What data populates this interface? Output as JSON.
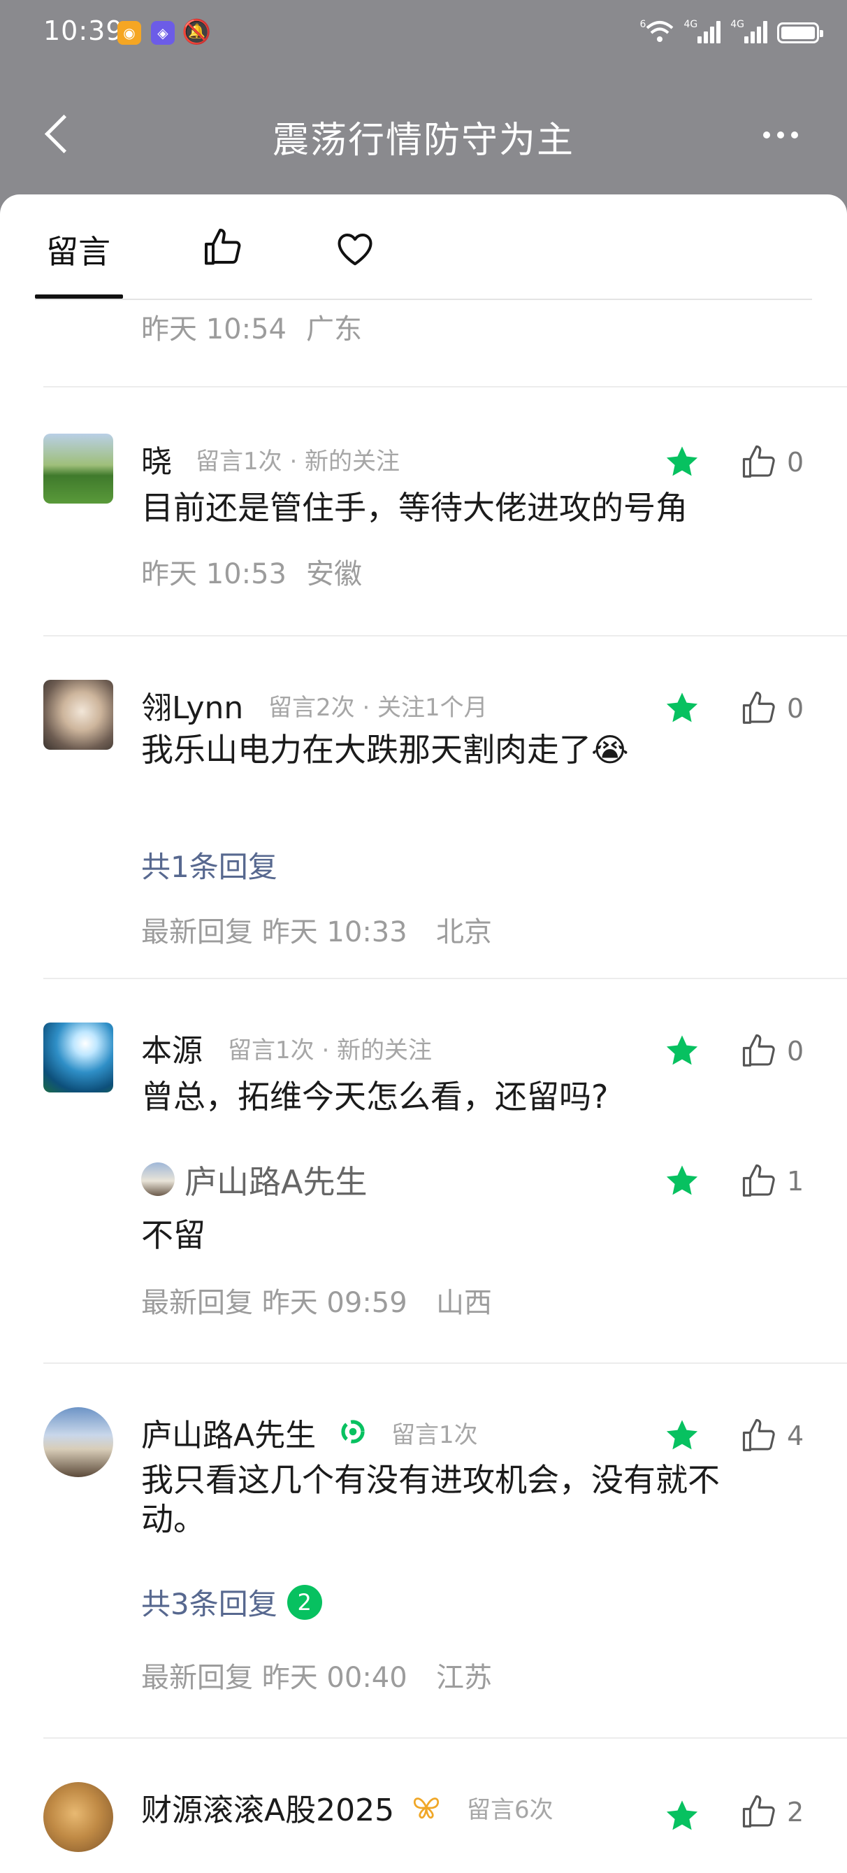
{
  "status": {
    "time": "10:39",
    "net1": "4G",
    "net2": "4G",
    "wifi_label": "6"
  },
  "nav": {
    "title": "震荡行情防守为主"
  },
  "tabs": {
    "messages": "留言"
  },
  "top_meta": {
    "time": "昨天 10:54",
    "location": "广东"
  },
  "comments": [
    {
      "name": "晓",
      "info": "留言1次 · 新的关注",
      "text": "目前还是管住手，等待大佬进攻的号角",
      "time": "昨天 10:53",
      "location": "安徽",
      "likes": "0"
    },
    {
      "name": "翎Lynn",
      "info": "留言2次 · 关注1个月",
      "text": "我乐山电力在大跌那天割肉走了😭",
      "replies": "共1条回复",
      "latest": "最新回复 昨天 10:33",
      "location": "北京",
      "likes": "0"
    },
    {
      "name": "本源",
      "info": "留言1次 · 新的关注",
      "text": "曾总，拓维今天怎么看，还留吗?",
      "likes": "0",
      "reply": {
        "name": "庐山路A先生",
        "text": "不留",
        "likes": "1"
      },
      "latest": "最新回复 昨天 09:59",
      "location": "山西"
    },
    {
      "name": "庐山路A先生",
      "info": "留言1次",
      "text": "我只看这几个有没有进攻机会，没有就不动。",
      "replies": "共3条回复",
      "badge": "2",
      "latest": "最新回复 昨天 00:40",
      "location": "江苏",
      "likes": "4"
    },
    {
      "name": "财源滚滚A股2025",
      "info": "留言6次",
      "likes": "2"
    }
  ],
  "colors": {
    "accent": "#07c160",
    "link": "#57688f",
    "header": "#8a8a8e"
  }
}
